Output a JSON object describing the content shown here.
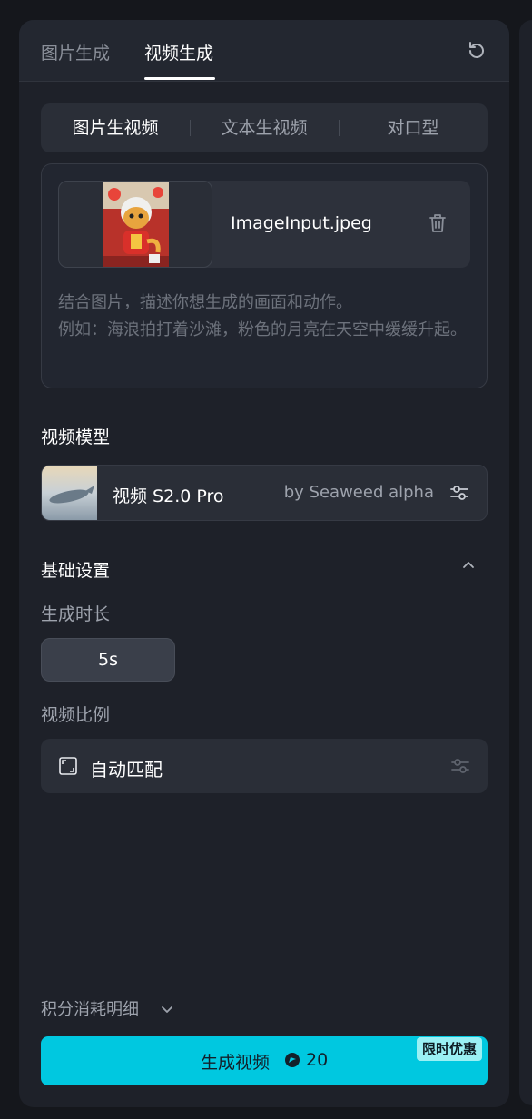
{
  "tabs": {
    "image_gen": "图片生成",
    "video_gen": "视频生成",
    "active": "视频生成"
  },
  "icons": {
    "reset": "refresh-icon",
    "trash": "trash-icon",
    "settings": "sliders-icon",
    "collapse": "chevron-up-icon",
    "expand": "chevron-down-icon",
    "ratio": "aspect-ratio-icon",
    "points": "credit-icon"
  },
  "mode": {
    "items": [
      "图片生视频",
      "文本生视频",
      "对口型"
    ],
    "active": "图片生视频"
  },
  "upload": {
    "file_name": "ImageInput.jpeg",
    "prompt_line1": "结合图片，描述你想生成的画面和动作。",
    "prompt_line2": "例如：海浪拍打着沙滩，粉色的月亮在天空中缓缓升起。"
  },
  "model": {
    "section_title": "视频模型",
    "name": "视频 S2.0 Pro",
    "by": "by Seaweed alpha"
  },
  "basic": {
    "section_title": "基础设置",
    "duration_label": "生成时长",
    "duration_value": "5s",
    "ratio_label": "视频比例",
    "ratio_value": "自动匹配"
  },
  "footer": {
    "points_detail": "积分消耗明细",
    "generate_label": "生成视频",
    "cost": "20",
    "badge": "限时优惠"
  },
  "colors": {
    "accent": "#00c8e0",
    "panel": "#1e2129",
    "badge": "#9af0f4"
  }
}
